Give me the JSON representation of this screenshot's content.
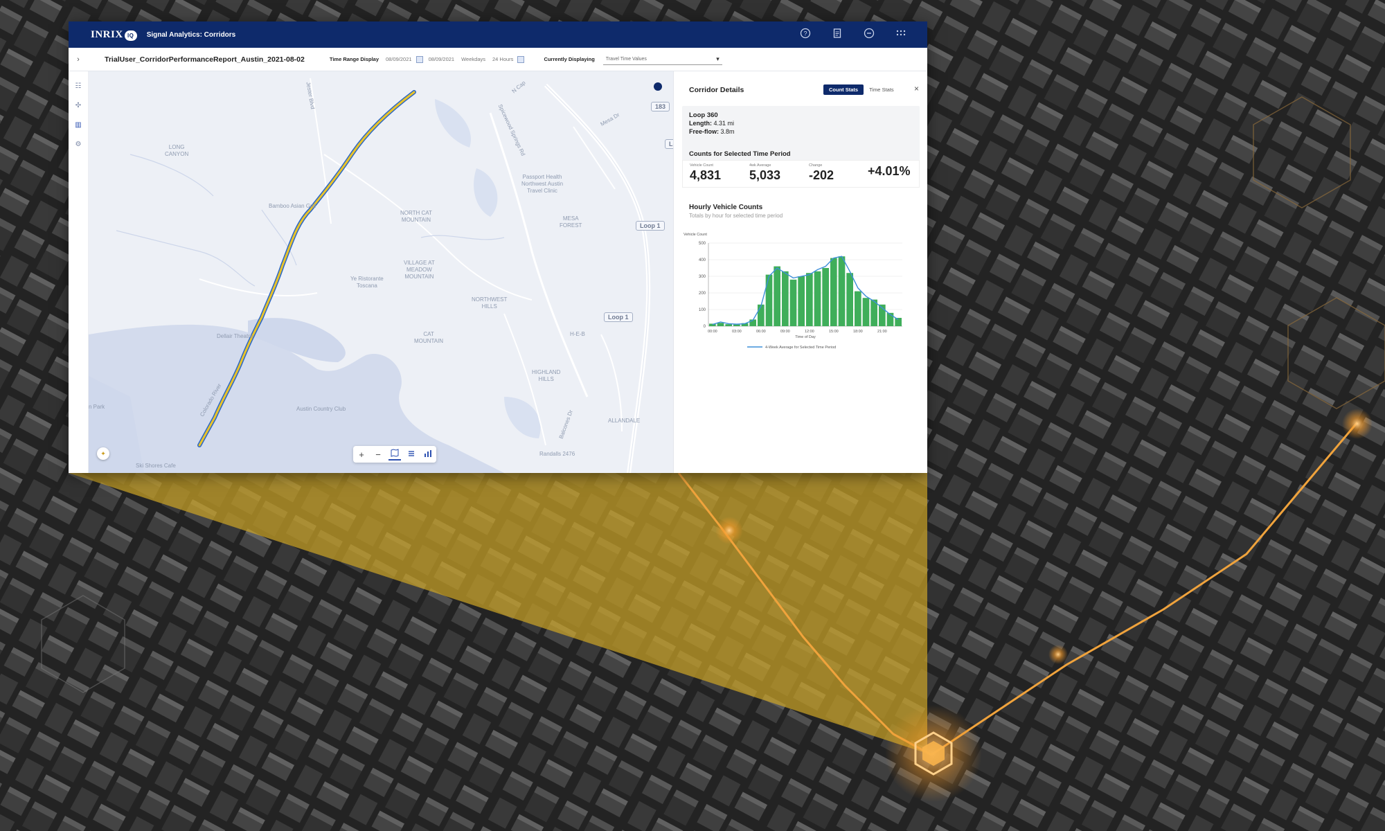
{
  "app": {
    "logo": "INRIX",
    "logo_badge": "IQ",
    "title": "Signal Analytics: Corridors"
  },
  "topbar_icons": [
    "help-icon",
    "document-icon",
    "minus-circle-icon",
    "apps-grid-icon"
  ],
  "subbar": {
    "report_name": "TrialUser_CorridorPerformanceReport_Austin_2021-08-02",
    "time_range_label": "Time Range Display",
    "start_date": "08/09/2021",
    "end_date": "08/09/2021",
    "days": "Weekdays",
    "hours": "24 Hours",
    "currently_displaying_label": "Currently Displaying",
    "currently_displaying_value": "Travel Time Values"
  },
  "map": {
    "labels": {
      "long_canyon": "LONG\nCANYON",
      "bamboo": "Bamboo Asian Grill",
      "north_cat": "NORTH CAT\nMOUNTAIN",
      "village": "VILLAGE AT\nMEADOW\nMOUNTAIN",
      "passport": "Passport Health\nNorthwest Austin\nTravel Clinic",
      "mesa_forest": "MESA\nFOREST",
      "northwest_hills": "NORTHWEST\nHILLS",
      "ristorante": "Ye Ristorante\nToscana",
      "cat_mountain": "CAT\nMOUNTAIN",
      "heb": "H-E-B",
      "highland_hills": "HIGHLAND\nHILLS",
      "allandale": "ALLANDALE",
      "dellair": "Dellair Theatre",
      "austin_cc": "Austin Country Club",
      "ski_shores": "Ski Shores Cafe",
      "park": "n Park",
      "randalls": "Randalls 2476",
      "mesa_dr": "Mesa Dr",
      "jester": "Jester Blvd",
      "spicewood": "Spicewood Springs Rd",
      "colorado": "Colorado River",
      "balcones": "Balcones Dr",
      "loop1_a": "Loop 1",
      "loop1_b": "Loop 1",
      "us183": "183",
      "lo": "Lo",
      "n_capital": "N Cap"
    },
    "tools": [
      "+",
      "−",
      "map-icon",
      "list-icon",
      "chart-icon"
    ]
  },
  "panel": {
    "title": "Corridor Details",
    "toggle_on": "Count Stats",
    "toggle_off": "Time Stats",
    "close": "×",
    "corridor_name": "Loop 360",
    "length_label": "Length:",
    "length_value": "4.31 mi",
    "freeflow_label": "Free-flow:",
    "freeflow_value": "3.8m",
    "counts_title": "Counts for Selected Time Period",
    "stats": [
      {
        "label": "Vehicle Count",
        "value": "4,831"
      },
      {
        "label": "4wk Average",
        "value": "5,033"
      },
      {
        "label": "Change",
        "value": "-202"
      },
      {
        "label": "",
        "value": "+4.01%"
      }
    ],
    "hourly_title": "Hourly Vehicle Counts",
    "hourly_sub": "Totals by hour for selected time period"
  },
  "chart_data": {
    "type": "bar",
    "ylabel": "Vehicle Count",
    "xlabel": "Time of Day",
    "ylim": [
      0,
      500
    ],
    "yticks": [
      0,
      100,
      200,
      300,
      400,
      500
    ],
    "xticks": [
      "00:00",
      "03:00",
      "06:00",
      "09:00",
      "12:00",
      "15:00",
      "18:00",
      "21:00"
    ],
    "series": [
      {
        "name": "Hourly Vehicle Count",
        "color": "#3fae5a",
        "values": [
          15,
          20,
          12,
          10,
          18,
          40,
          130,
          310,
          360,
          330,
          280,
          300,
          320,
          330,
          350,
          410,
          420,
          320,
          210,
          170,
          160,
          130,
          80,
          50
        ]
      },
      {
        "name": "4-Week Average for Selected Time Period",
        "color": "#3d8fd9",
        "kind": "line",
        "values": [
          10,
          25,
          15,
          12,
          15,
          35,
          120,
          300,
          350,
          320,
          290,
          300,
          310,
          340,
          360,
          410,
          420,
          330,
          230,
          180,
          150,
          110,
          70,
          40
        ]
      }
    ],
    "legend": "bottom"
  },
  "colors": {
    "navy": "#0e2a6b",
    "route": "#e8c32a",
    "bar": "#3fae5a",
    "avg_line": "#3d8fd9",
    "gold_overlay": "#c9a227"
  }
}
